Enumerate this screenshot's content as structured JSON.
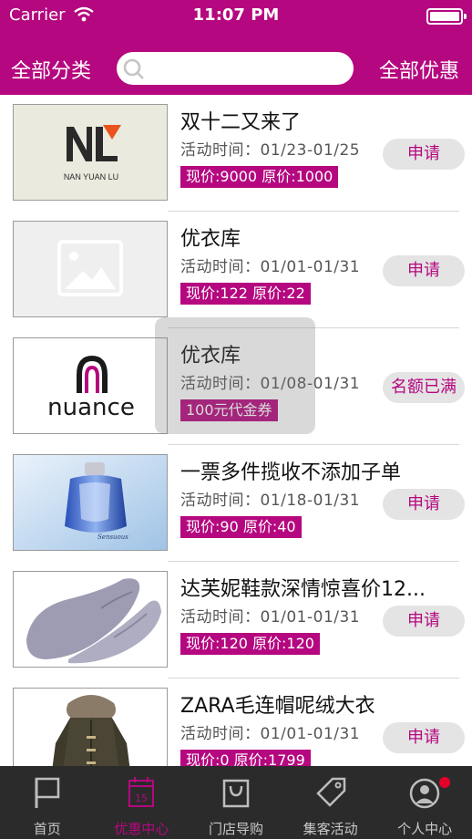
{
  "status_bar": {
    "carrier": "Carrier",
    "time": "11:07 PM",
    "battery_level": 1.0
  },
  "header": {
    "left_label": "全部分类",
    "right_label": "全部优惠",
    "search_placeholder": ""
  },
  "deals": [
    {
      "title": "双十二又来了",
      "time": "活动时间：01/23-01/25",
      "price": "现价:9000  原价:1000",
      "button": "申请",
      "image": "nan-yuan-lu-logo",
      "logo_text": "NAN YUAN LU"
    },
    {
      "title": "优衣库",
      "time": "活动时间：01/01-01/31",
      "price": "现价:122  原价:22",
      "button": "申请",
      "image": "placeholder-image"
    },
    {
      "title": "优衣库",
      "time": "活动时间：01/08-01/31",
      "price": "100元代金券",
      "button": "名额已满",
      "image": "nuance-logo",
      "logo_text": "nuance"
    },
    {
      "title": "一票多件揽收不添加子单",
      "time": "活动时间：01/18-01/31",
      "price": "现价:90  原价:40",
      "button": "申请",
      "image": "perfume-bottle"
    },
    {
      "title": "达芙妮鞋款深情惊喜价12...",
      "time": "活动时间：01/01-01/31",
      "price": "现价:120  原价:120",
      "button": "申请",
      "image": "loafer-shoe"
    },
    {
      "title": "ZARA毛连帽呢绒大衣",
      "time": "活动时间：01/01-01/31",
      "price": "现价:0  原价:1799",
      "button": "申请",
      "image": "hooded-coat"
    }
  ],
  "tabbar": {
    "active": "优惠中心",
    "tabs": [
      {
        "label": "首页",
        "icon": "flag-icon"
      },
      {
        "label": "优惠中心",
        "icon": "calendar-icon",
        "icon_text": "15"
      },
      {
        "label": "门店导购",
        "icon": "shopping-bag-icon"
      },
      {
        "label": "集客活动",
        "icon": "tag-icon"
      },
      {
        "label": "个人中心",
        "icon": "user-icon",
        "has_badge": true
      }
    ]
  },
  "colors": {
    "brand": "#b5077f",
    "tabbar": "#2b2b2b",
    "badge": "#e5002a"
  }
}
